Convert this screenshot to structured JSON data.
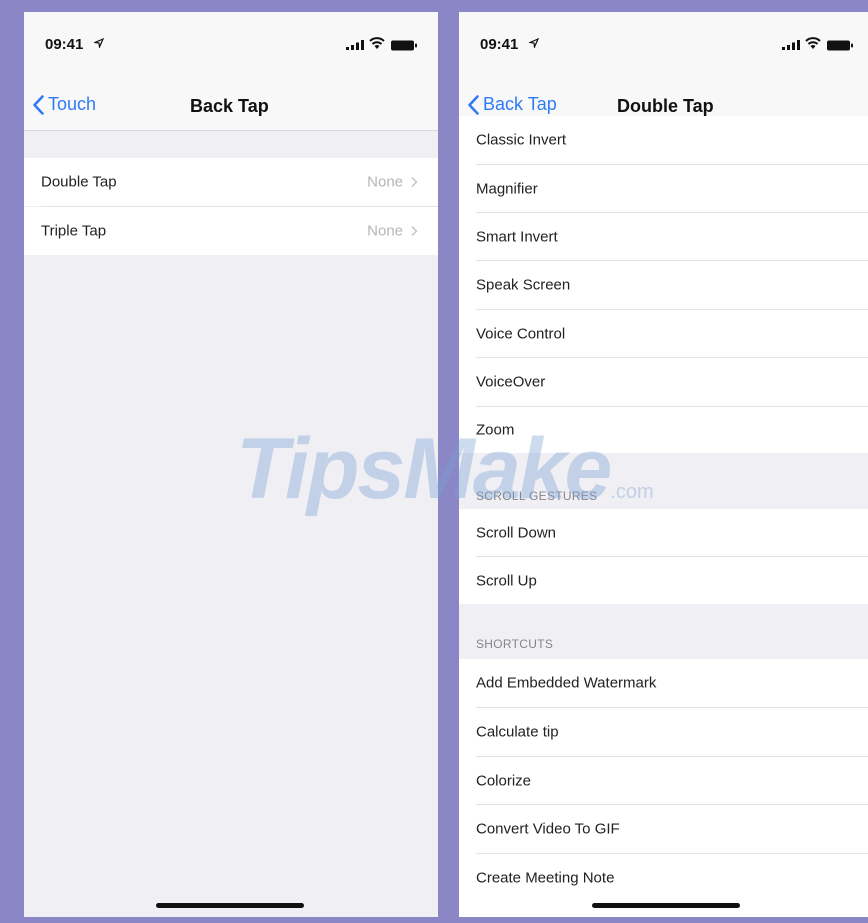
{
  "left": {
    "status": {
      "time": "09:41"
    },
    "nav": {
      "back_label": "Touch",
      "title": "Back Tap"
    },
    "rows": [
      {
        "label": "Double Tap",
        "value": "None"
      },
      {
        "label": "Triple Tap",
        "value": "None"
      }
    ]
  },
  "right": {
    "status": {
      "time": "09:41"
    },
    "nav": {
      "back_label": "Back Tap",
      "title": "Double Tap"
    },
    "accessibility_items": [
      "Classic Invert",
      "Magnifier",
      "Smart Invert",
      "Speak Screen",
      "Voice Control",
      "VoiceOver",
      "Zoom"
    ],
    "scroll_gestures": {
      "header": "SCROLL GESTURES",
      "items": [
        "Scroll Down",
        "Scroll Up"
      ]
    },
    "shortcuts": {
      "header": "SHORTCUTS",
      "items": [
        "Add Embedded Watermark",
        "Calculate tip",
        "Colorize",
        "Convert Video To GIF",
        "Create Meeting Note"
      ]
    }
  },
  "watermark": {
    "main": "TipsMake",
    "suffix": ".com"
  },
  "colors": {
    "accent": "#2f7bf6",
    "frame": "#8b86c6",
    "grouped_bg": "#efeff4"
  }
}
